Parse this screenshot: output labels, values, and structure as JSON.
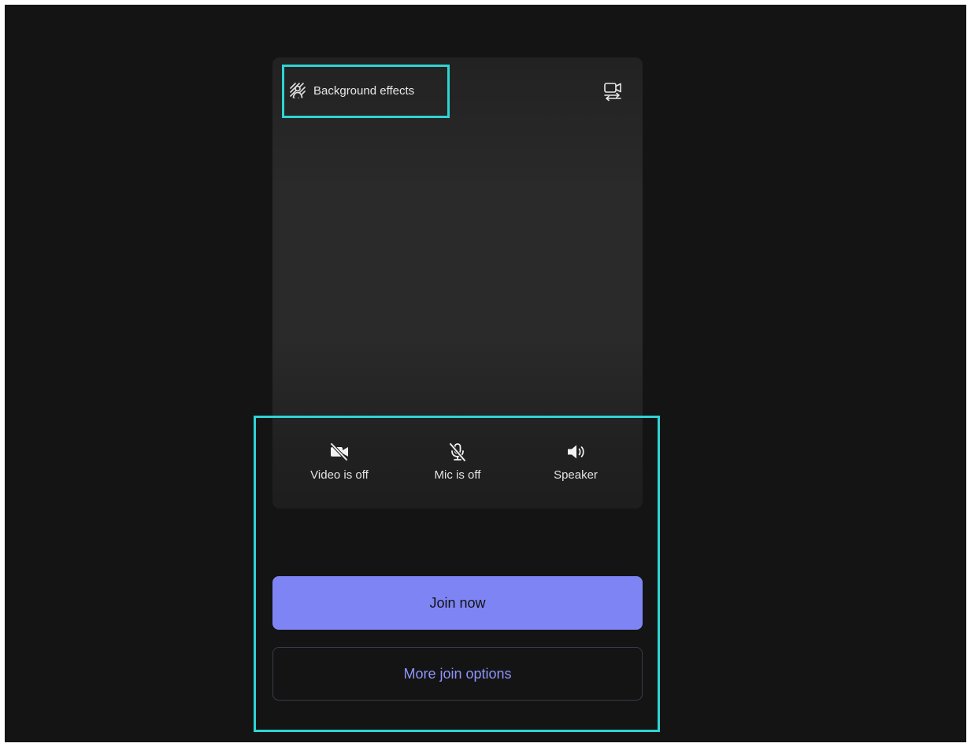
{
  "preview": {
    "background_effects_label": "Background effects",
    "background_effects_icon": "background-effects-icon",
    "switch_camera_icon": "switch-camera-icon"
  },
  "controls": {
    "video": {
      "label": "Video is off",
      "icon": "video-off-icon"
    },
    "mic": {
      "label": "Mic is off",
      "icon": "mic-off-icon"
    },
    "speaker": {
      "label": "Speaker",
      "icon": "speaker-icon"
    }
  },
  "actions": {
    "join_now_label": "Join now",
    "more_join_options_label": "More join options"
  },
  "colors": {
    "screen_bg": "#141414",
    "preview_bg": "#2a2a2a",
    "primary_button": "#7f84f5",
    "secondary_text": "#8f93fb",
    "highlight": "#2fd4d4"
  }
}
